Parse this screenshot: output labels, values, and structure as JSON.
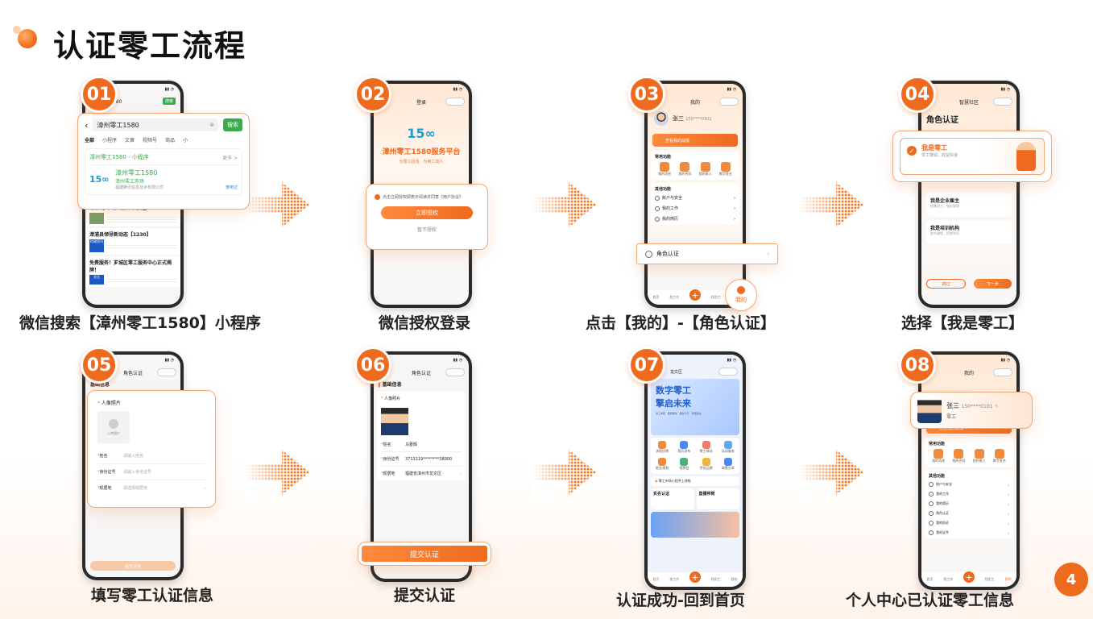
{
  "title": "认证零工流程",
  "page_number": "4",
  "colors": {
    "accent": "#ee6a1e",
    "accent_light": "#ffe7d3"
  },
  "steps": [
    {
      "num": "01",
      "caption": "微信搜索【漳州零工1580】小程序",
      "search_query": "漳州零工1580",
      "search_btn": "搜索",
      "filters": [
        "全部",
        "小程序",
        "文章",
        "视频号",
        "商品",
        "小"
      ],
      "result_header": "漳州零工1580 - 小程序",
      "more": "更多 >",
      "result_title": "漳州零工1580",
      "result_sub": "漳州零工市场",
      "result_org": "福建腾讯信息技术有限公司",
      "used": "使用过",
      "news": [
        "零工\"小市场\" 就业\"大民生\"",
        "漳浦县领导新动态【1230】",
        "免费服务！芗城区零工服务中心正式揭牌！"
      ],
      "news_tags": [
        "时政资讯",
        "关注"
      ],
      "top_search": "漳州零工1580"
    },
    {
      "num": "02",
      "caption": "微信授权登录",
      "nav_title": "登录",
      "app_name": "漳州零工1580服务平台",
      "slogan": "为零工找活 · 为用工找人",
      "agree": "点击立即授权即表示阅读并同意《用户协议》",
      "auth_btn": "立即授权",
      "skip": "暂不授权"
    },
    {
      "num": "03",
      "caption": "点击【我的】-【角色认证】",
      "nav_title": "我的",
      "user_name": "张三",
      "phone": "150****0101",
      "banner": "查看我的战报",
      "sec1": "常用功能",
      "funcs": [
        "我的消息",
        "我的合同",
        "我的收入",
        "数字签名"
      ],
      "sec2": "其他功能",
      "others": [
        "账户与安全",
        "我的工作",
        "我的简历"
      ],
      "role_item": "角色认证",
      "my_label": "我的",
      "tabs": [
        "首页",
        "找工作",
        "就业帮",
        "找用工",
        "我的"
      ]
    },
    {
      "num": "04",
      "caption": "选择【我是零工】",
      "nav_title": "智慧社区",
      "page_title": "角色认证",
      "role_main": "我是零工",
      "role_main_sub": "零工赚钱，收益快速",
      "roles": [
        {
          "title": "我是企业雇主",
          "sub": "招聘员工，轻松管理"
        },
        {
          "title": "我是培训机构",
          "sub": "发布课程，招收学员"
        }
      ],
      "btn_left": "跳过",
      "btn_right": "下一步"
    },
    {
      "num": "05",
      "caption": "填写零工认证信息",
      "nav_title": "角色认证",
      "section": "基础信息",
      "photo_label": "人像照片",
      "upload": "上传照片",
      "fields": [
        {
          "label": "姓名",
          "placeholder": "请输入姓名"
        },
        {
          "label": "身份证号",
          "placeholder": "请输入身份证号"
        },
        {
          "label": "现居地",
          "placeholder": "请选择现居地"
        }
      ],
      "submit": "提交认证"
    },
    {
      "num": "06",
      "caption": "提交认证",
      "nav_title": "角色认证",
      "section": "基础信息",
      "photo_label": "人像照片",
      "fields": [
        {
          "label": "姓名",
          "value": "马晋辉"
        },
        {
          "label": "身份证号",
          "value": "3713119********38000"
        },
        {
          "label": "现居地",
          "value": "福建省漳州市龙文区"
        }
      ],
      "submit": "提交认证"
    },
    {
      "num": "07",
      "caption": "认证成功-回到首页",
      "location": "龙文区",
      "hero_title_1": "数字零工",
      "hero_title_2": "擎启未来",
      "hero_sub": "零工求职 · 便民服务 · 服务大厅 · 智慧就业",
      "services": [
        "求职应聘",
        "简历发布",
        "零工驿站",
        "培训服务",
        "职业规划",
        "招聘会",
        "劳务品牌",
        "政策分享"
      ],
      "notice": "零工市场小程序上线啦",
      "card1": "实名认证",
      "card2": "直播带岗",
      "tabs": [
        "首页",
        "找工作",
        "就业帮",
        "找用工",
        "我的"
      ]
    },
    {
      "num": "08",
      "caption": "个人中心已认证零工信息",
      "nav_title": "我的",
      "user_name": "张三",
      "phone": "150****0101",
      "role_tag": "零工",
      "banner": "查看我的战报",
      "sec1": "常用功能",
      "funcs": [
        "我的消息",
        "我的合同",
        "我的收入",
        "数字签名"
      ],
      "sec2": "其他功能",
      "others": [
        "账户与安全",
        "我的工作",
        "我的简历",
        "角色认证",
        "我的投诉",
        "我的证件"
      ],
      "tabs": [
        "首页",
        "找工作",
        "就业帮",
        "找用工",
        "我的"
      ]
    }
  ]
}
